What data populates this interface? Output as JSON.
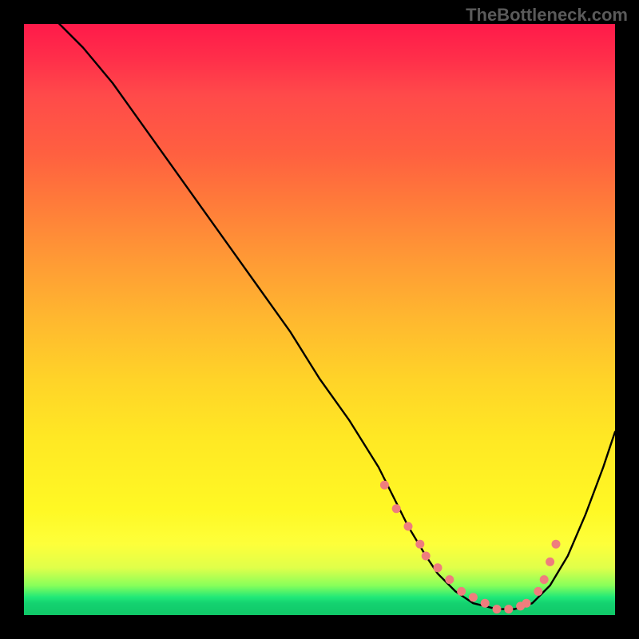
{
  "watermark": "TheBottleneck.com",
  "chart_data": {
    "type": "line",
    "title": "",
    "xlabel": "",
    "ylabel": "",
    "xlim": [
      0,
      100
    ],
    "ylim": [
      0,
      100
    ],
    "series": [
      {
        "name": "curve",
        "x": [
          0,
          5,
          10,
          15,
          20,
          25,
          30,
          35,
          40,
          45,
          50,
          55,
          60,
          62,
          65,
          68,
          70,
          73,
          76,
          80,
          83,
          86,
          89,
          92,
          95,
          98,
          100
        ],
        "y": [
          105,
          101,
          96,
          90,
          83,
          76,
          69,
          62,
          55,
          48,
          40,
          33,
          25,
          21,
          15,
          10,
          7,
          4,
          2,
          1,
          1,
          2,
          5,
          10,
          17,
          25,
          31
        ]
      }
    ],
    "highlight_points": {
      "name": "marker-band",
      "x": [
        61,
        63,
        65,
        67,
        68,
        70,
        72,
        74,
        76,
        78,
        80,
        82,
        84,
        85,
        87,
        88,
        89,
        90
      ],
      "y": [
        22,
        18,
        15,
        12,
        10,
        8,
        6,
        4,
        3,
        2,
        1,
        1,
        1.5,
        2,
        4,
        6,
        9,
        12
      ]
    },
    "gradient_stops": [
      {
        "pos": 0,
        "color": "#ff1a4a"
      },
      {
        "pos": 12,
        "color": "#ff4a4a"
      },
      {
        "pos": 30,
        "color": "#ff7a3a"
      },
      {
        "pos": 50,
        "color": "#ffb82f"
      },
      {
        "pos": 70,
        "color": "#ffe824"
      },
      {
        "pos": 88,
        "color": "#fdff3a"
      },
      {
        "pos": 95,
        "color": "#88ff5a"
      },
      {
        "pos": 100,
        "color": "#10c868"
      }
    ]
  }
}
